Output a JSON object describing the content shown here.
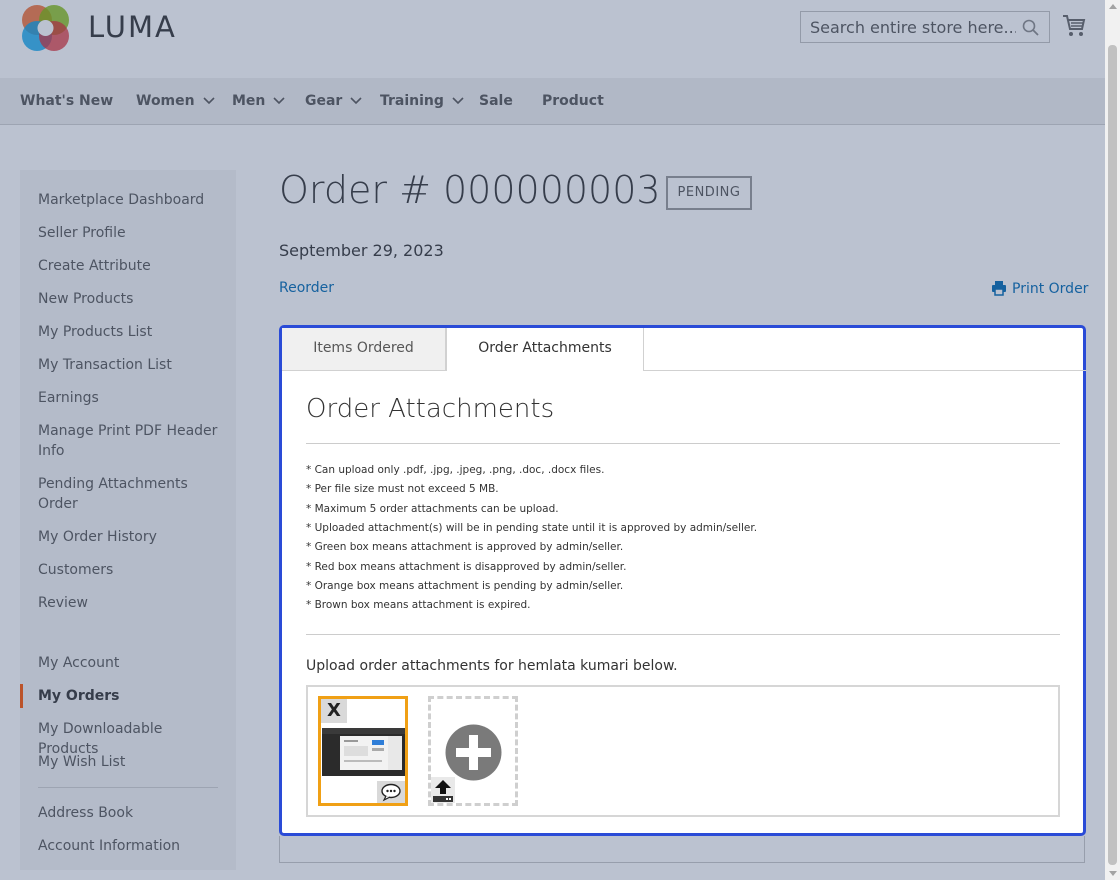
{
  "header": {
    "logo_text": "LUMA",
    "search_placeholder": "Search entire store here...",
    "icons": [
      "luma-logo-icon",
      "search-icon",
      "cart-icon"
    ]
  },
  "nav": {
    "items": [
      {
        "label": "What's New"
      },
      {
        "label": "Women"
      },
      {
        "label": "Men"
      },
      {
        "label": "Gear"
      },
      {
        "label": "Training"
      },
      {
        "label": "Sale"
      },
      {
        "label": "Product"
      }
    ]
  },
  "sidebar": {
    "items": [
      "Marketplace Dashboard",
      "Seller Profile",
      "Create Attribute",
      "New Products",
      "My Products List",
      "My Transaction List",
      "Earnings",
      "Manage Print PDF Header Info",
      "Pending Attachments Order",
      "My Order History",
      "Customers",
      "Review"
    ],
    "account_items": [
      "My Account",
      "My Orders",
      "My Downloadable Products",
      "My Wish List"
    ],
    "bottom_items": [
      "Address Book",
      "Account Information"
    ],
    "active": "My Orders"
  },
  "order": {
    "title": "Order # 000000003",
    "status": "PENDING",
    "date": "September 29, 2023",
    "reorder": "Reorder",
    "print": "Print Order"
  },
  "tabs": {
    "items_ordered": "Items Ordered",
    "order_attachments": "Order Attachments",
    "active": "Order Attachments"
  },
  "attachments": {
    "heading": "Order Attachments",
    "notes": [
      "* Can upload only .pdf, .jpg, .jpeg, .png, .doc, .docx files.",
      "* Per file size must not exceed 5 MB.",
      "* Maximum 5 order attachments can be upload.",
      "* Uploaded attachment(s) will be in pending state until it is approved by admin/seller.",
      "* Green box means attachment is approved by admin/seller.",
      "* Red box means attachment is disapproved by admin/seller.",
      "* Orange box means attachment is pending by admin/seller.",
      "* Brown box means attachment is expired."
    ],
    "upload_label": "Upload order attachments for hemlata kumari below.",
    "remove_label": "X",
    "pending_color": "#f0a015"
  },
  "colors": {
    "link": "#006bb4",
    "panel_border": "#2a4bd7",
    "active_marker": "#ff5501"
  }
}
